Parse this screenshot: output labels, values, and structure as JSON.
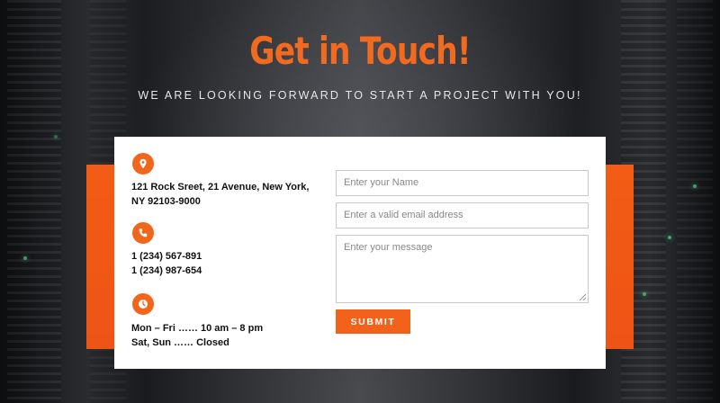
{
  "header": {
    "title": "Get in Touch!",
    "subtitle": "WE ARE LOOKING FORWARD TO START A PROJECT WITH YOU!"
  },
  "contact": {
    "address_line1": "121 Rock Sreet, 21 Avenue, New York,",
    "address_line2": "NY 92103-9000",
    "phone1": "1 (234) 567-891",
    "phone2": "1 (234) 987-654",
    "hours_line1": "Mon – Fri …… 10 am – 8 pm",
    "hours_line2": "Sat, Sun …… Closed"
  },
  "form": {
    "name_placeholder": "Enter your Name",
    "email_placeholder": "Enter a valid email address",
    "message_placeholder": "Enter your message",
    "submit_label": "SUBMIT"
  },
  "colors": {
    "accent": "#f26a1f",
    "band": "#f25c14"
  },
  "icons": [
    "map-pin-icon",
    "phone-icon",
    "clock-icon"
  ]
}
